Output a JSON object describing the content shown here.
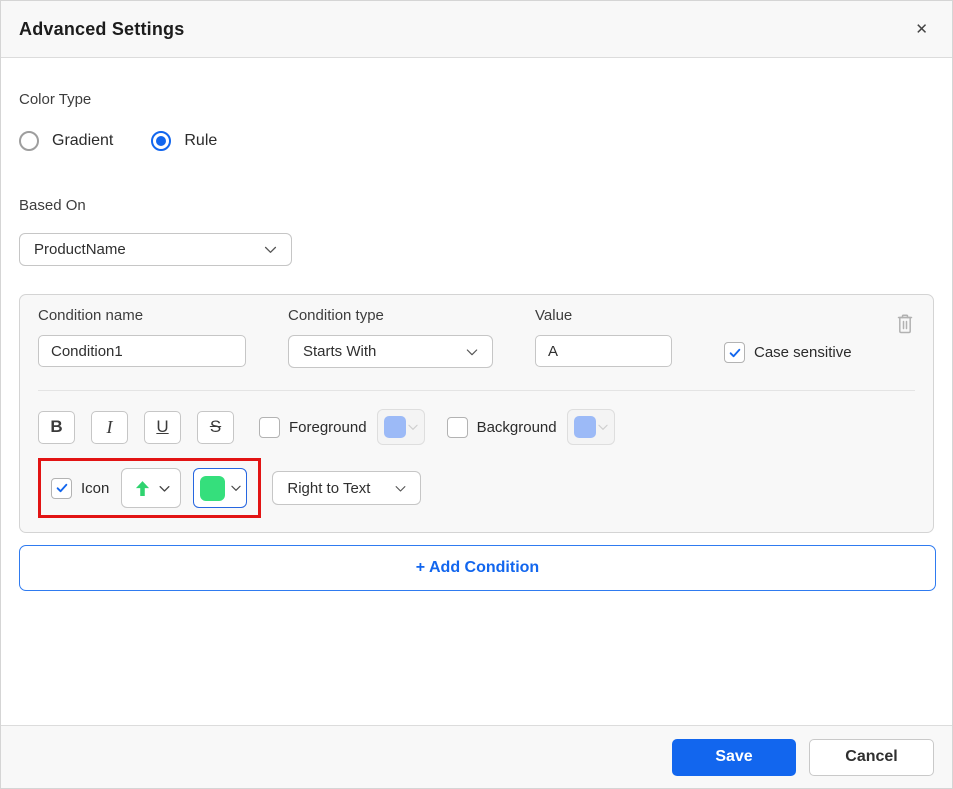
{
  "dialog": {
    "title": "Advanced Settings"
  },
  "icons": {
    "close": "✕",
    "trash": "trash-can-outline",
    "chevron": "chevron-down",
    "up_arrow": "arrow-up"
  },
  "colors": {
    "accent_blue": "#1266ee",
    "swatch_blue": "#9cbaf7",
    "icon_green": "#35df7c",
    "arrow_green": "#2fd36f",
    "highlight_red": "#e21414",
    "header_bg": "#f8f8f8",
    "panel_bg": "#f8f8f8"
  },
  "color_type": {
    "label": "Color Type",
    "options": [
      {
        "label": "Gradient",
        "selected": false
      },
      {
        "label": "Rule",
        "selected": true
      }
    ]
  },
  "based_on": {
    "label": "Based On",
    "value": "ProductName"
  },
  "condition": {
    "name": {
      "label": "Condition name",
      "value": "Condition1"
    },
    "type": {
      "label": "Condition type",
      "value": "Starts With"
    },
    "value": {
      "label": "Value",
      "value": "A"
    },
    "case_sensitive": {
      "label": "Case sensitive",
      "checked": true
    },
    "format_buttons": [
      {
        "name": "bold",
        "glyph": "B"
      },
      {
        "name": "italic",
        "glyph": "I"
      },
      {
        "name": "underline",
        "glyph": "U"
      },
      {
        "name": "strikethrough",
        "glyph": "S"
      }
    ],
    "foreground": {
      "label": "Foreground",
      "checked": false,
      "swatch_color": "#9cbaf7"
    },
    "background": {
      "label": "Background",
      "checked": false,
      "swatch_color": "#9cbaf7"
    },
    "icon": {
      "label": "Icon",
      "checked": true,
      "icon_color": "#2fd36f",
      "swatch_color": "#35df7c",
      "position_value": "Right to Text"
    }
  },
  "add_condition": {
    "label": "+ Add Condition"
  },
  "footer": {
    "save_label": "Save",
    "cancel_label": "Cancel"
  }
}
